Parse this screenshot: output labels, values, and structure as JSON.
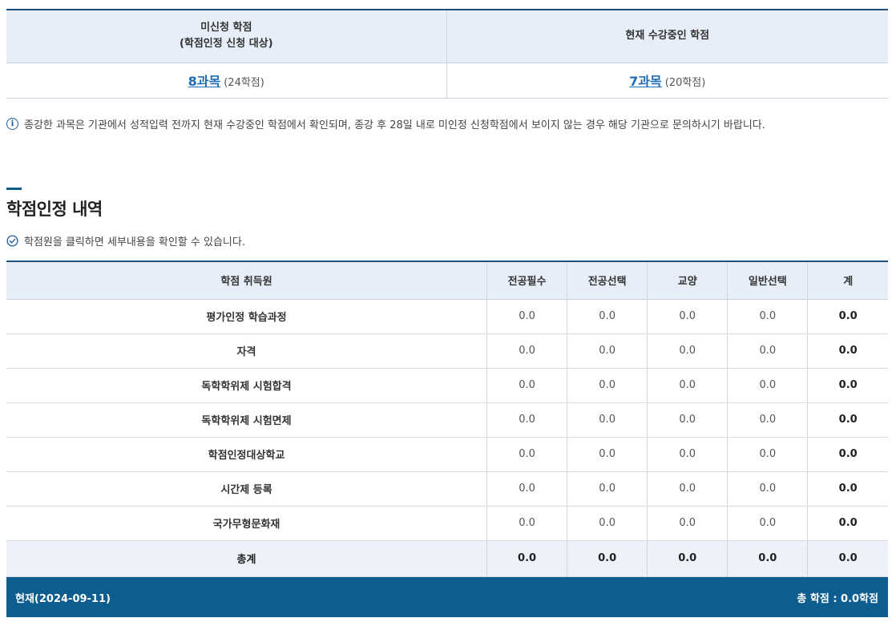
{
  "summary": {
    "col_unapplied_line1": "미신청 학점",
    "col_unapplied_line2": "(학점인정 신청 대상)",
    "col_current": "현재 수강중인 학점",
    "unapplied_count": "8과목",
    "unapplied_credits": "(24학점)",
    "current_count": "7과목",
    "current_credits": "(20학점)"
  },
  "notice": {
    "icon": "info-icon",
    "text": "종강한 과목은 기관에서 성적입력 전까지 현재 수강중인 학점에서 확인되며, 종강 후 28일 내로 미인정 신청학점에서 보이지 않는 경우 해당 기관으로 문의하시기 바랍니다."
  },
  "section": {
    "title": "학점인정 내역",
    "hint_icon": "check-circle-icon",
    "hint": "학점원을 클릭하면 세부내용을 확인할 수 있습니다."
  },
  "table": {
    "headers": [
      "학점 취득원",
      "전공필수",
      "전공선택",
      "교양",
      "일반선택",
      "계"
    ],
    "rows": [
      {
        "name": "평가인정 학습과정",
        "values": [
          "0.0",
          "0.0",
          "0.0",
          "0.0",
          "0.0"
        ]
      },
      {
        "name": "자격",
        "values": [
          "0.0",
          "0.0",
          "0.0",
          "0.0",
          "0.0"
        ]
      },
      {
        "name": "독학학위제 시험합격",
        "values": [
          "0.0",
          "0.0",
          "0.0",
          "0.0",
          "0.0"
        ]
      },
      {
        "name": "독학학위제 시험면제",
        "values": [
          "0.0",
          "0.0",
          "0.0",
          "0.0",
          "0.0"
        ]
      },
      {
        "name": "학점인정대상학교",
        "values": [
          "0.0",
          "0.0",
          "0.0",
          "0.0",
          "0.0"
        ]
      },
      {
        "name": "시간제 등록",
        "values": [
          "0.0",
          "0.0",
          "0.0",
          "0.0",
          "0.0"
        ]
      },
      {
        "name": "국가무형문화재",
        "values": [
          "0.0",
          "0.0",
          "0.0",
          "0.0",
          "0.0"
        ]
      }
    ],
    "total": {
      "name": "총계",
      "values": [
        "0.0",
        "0.0",
        "0.0",
        "0.0",
        "0.0"
      ]
    }
  },
  "footer": {
    "date": "현재(2024-09-11)",
    "total": "총 학점 : 0.0학점"
  },
  "colors": {
    "accent": "#0e5d8f",
    "link": "#1f6db3",
    "header_bg": "#e8eef7"
  }
}
